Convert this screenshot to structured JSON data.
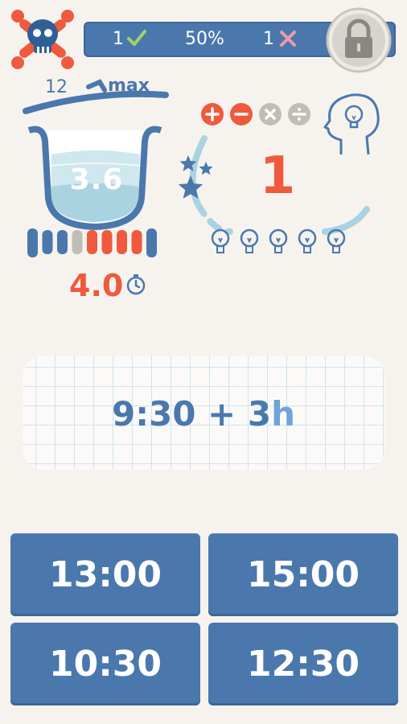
{
  "status": {
    "correct_count": "1",
    "percent": "50%",
    "wrong_count": "1"
  },
  "pot": {
    "level_label": "12",
    "max_label": "max",
    "value": "3.6",
    "fill_fraction": 0.35
  },
  "heat": {
    "segments_total": 9,
    "active_segment_index": 3
  },
  "timer": {
    "value": "4.0"
  },
  "level": {
    "number": "1",
    "hints_total": 5,
    "stars": 3
  },
  "operations": [
    "plus",
    "minus",
    "times",
    "divide"
  ],
  "question": {
    "expression": "9:30 + 3",
    "unit": "h"
  },
  "answers": [
    "13:00",
    "15:00",
    "10:30",
    "12:30"
  ],
  "colors": {
    "background": "#f6f3ef",
    "primary": "#4a78ad",
    "accent": "#ef5a3c",
    "light_blue": "#a9d3e1",
    "grey": "#c0bdb7"
  }
}
